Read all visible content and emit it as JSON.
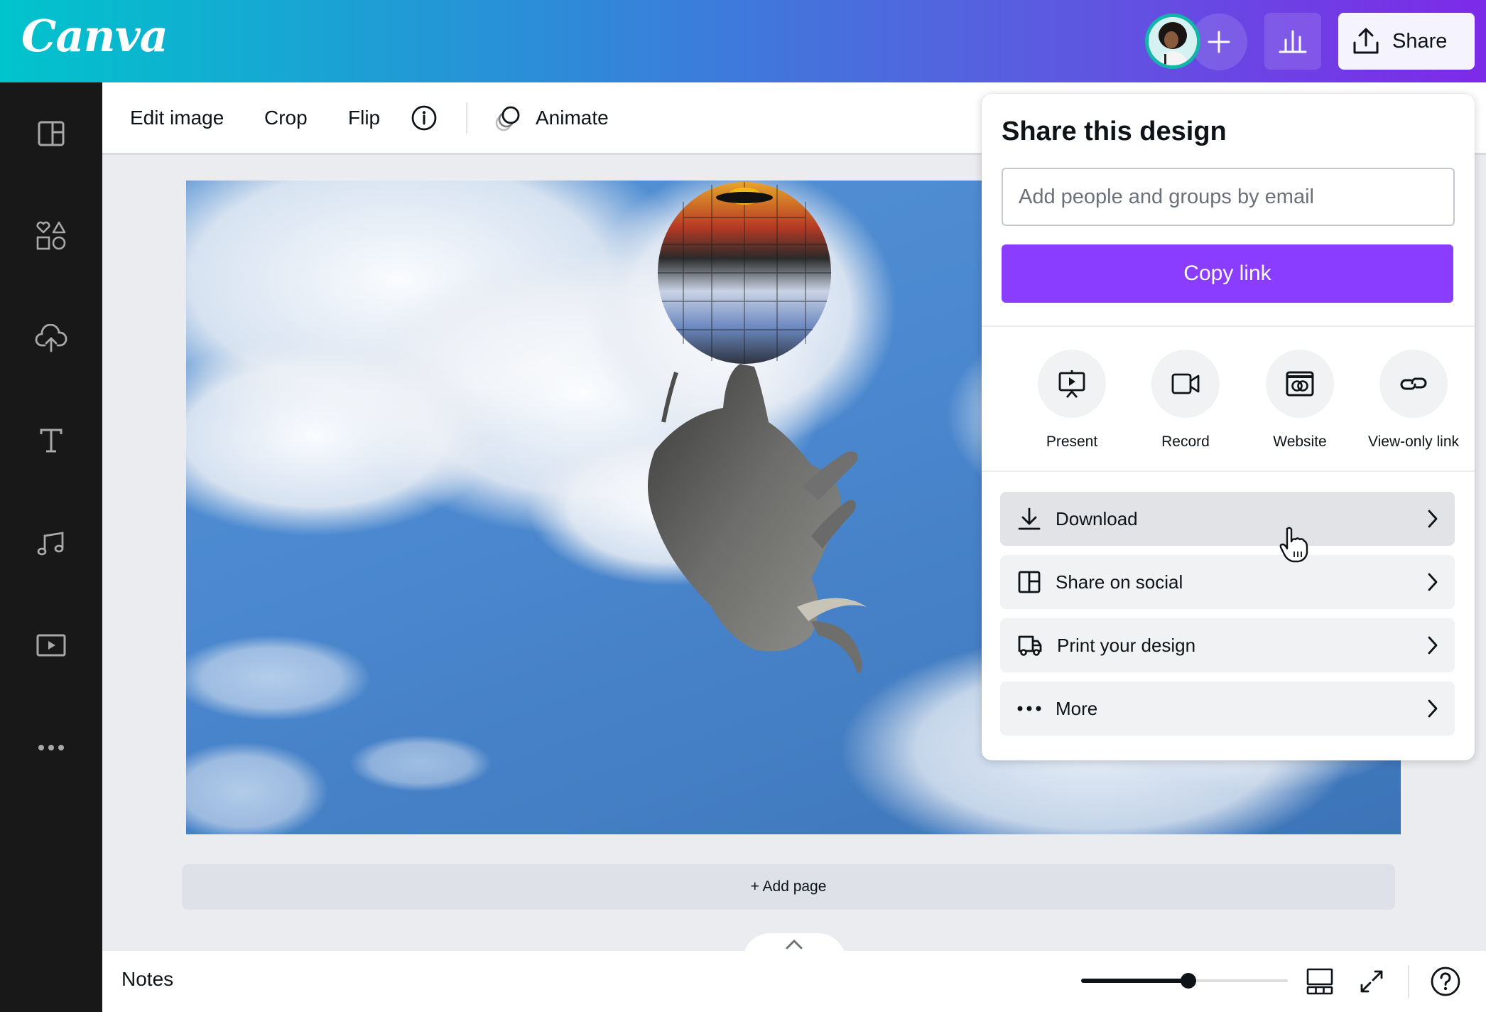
{
  "header": {
    "logo": "Canva",
    "add_collaborator_icon": "plus-icon",
    "insights_icon": "bar-chart-icon",
    "share_label": "Share",
    "share_icon": "upload-icon",
    "gradient_colors": [
      "#00C4CC",
      "#7D2AE8"
    ]
  },
  "sidebar": {
    "items": [
      {
        "name": "templates",
        "icon": "layout-icon"
      },
      {
        "name": "elements",
        "icon": "shapes-icon"
      },
      {
        "name": "uploads",
        "icon": "cloud-upload-icon"
      },
      {
        "name": "text",
        "icon": "text-icon"
      },
      {
        "name": "audio",
        "icon": "music-icon"
      },
      {
        "name": "videos",
        "icon": "video-icon"
      },
      {
        "name": "more",
        "icon": "more-icon"
      }
    ]
  },
  "toolbar": {
    "edit_image": "Edit image",
    "crop": "Crop",
    "flip": "Flip",
    "info_icon": "info-icon",
    "animate": "Animate",
    "animate_icon": "animate-icon"
  },
  "canvas": {
    "image_description": "Upside-down elephant balancing on a mirrored disco ball against a cloudy blue sky",
    "add_page": "+ Add page"
  },
  "bottombar": {
    "notes": "Notes",
    "zoom_percent": 52,
    "grid_view_icon": "grid-view-icon",
    "fullscreen_icon": "expand-icon",
    "help_icon": "help-icon",
    "expand_panel_icon": "chevron-up-icon"
  },
  "share_panel": {
    "title": "Share this design",
    "email_placeholder": "Add people and groups by email",
    "email_value": "",
    "copy_link": "Copy link",
    "accent_color": "#8B3DFF",
    "quick_actions": [
      {
        "label": "Present",
        "icon": "present-icon"
      },
      {
        "label": "Record",
        "icon": "video-camera-icon"
      },
      {
        "label": "Website",
        "icon": "website-icon"
      },
      {
        "label": "View-only link",
        "icon": "link-icon"
      }
    ],
    "rows": [
      {
        "label": "Download",
        "icon": "download-icon",
        "hovered": true
      },
      {
        "label": "Share on social",
        "icon": "social-layout-icon",
        "hovered": false
      },
      {
        "label": "Print your design",
        "icon": "truck-icon",
        "hovered": false
      },
      {
        "label": "More",
        "icon": "more-dots-icon",
        "hovered": false
      }
    ]
  }
}
